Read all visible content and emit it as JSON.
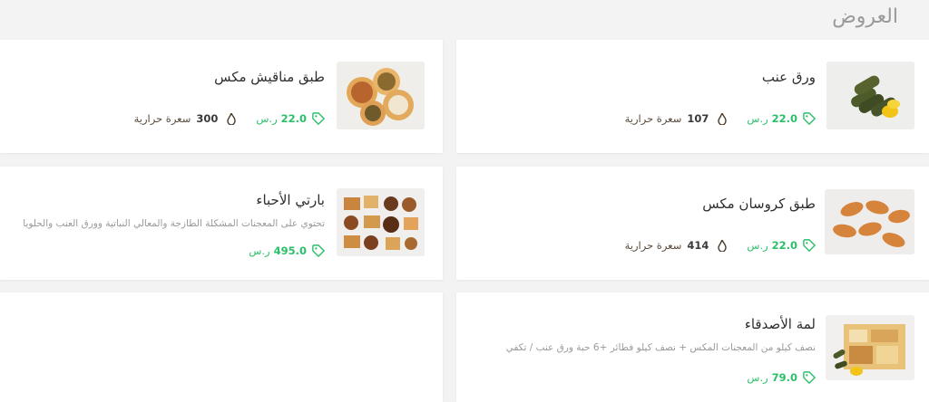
{
  "section": {
    "title": "العروض"
  },
  "offers": [
    {
      "name": "ورق عنب",
      "price": "22.0",
      "currency": "ر.س",
      "calories": "107",
      "calories_unit": "سعرة حرارية",
      "image": "stuffed-grape-leaves-with-lemon"
    },
    {
      "name": "طبق مناقيش مكس",
      "price": "22.0",
      "currency": "ر.س",
      "calories": "300",
      "calories_unit": "سعرة حرارية",
      "image": "mixed-manakish-plate"
    },
    {
      "name": "طبق كروسان مكس",
      "price": "22.0",
      "currency": "ر.س",
      "calories": "414",
      "calories_unit": "سعرة حرارية",
      "image": "mixed-croissant-plate"
    },
    {
      "name": "بارتي الأحباء",
      "description": "تحتوي على المعجنات المشكلة الطازجة والمعالي النباتية وورق العنب والحلويا",
      "price": "495.0",
      "currency": "ر.س",
      "image": "party-platter"
    },
    {
      "name": "لمة الأصدقاء",
      "description_line1": "نصف كيلو من المعجنات المكس + نصف كيلو فطائر +6 حبة ورق عنب / تكفي",
      "description_line2": "",
      "price": "79.0",
      "currency": "ر.س",
      "image": "friends-gathering-platter"
    }
  ],
  "colors": {
    "price": "#2bbf6a",
    "title": "#9a9a9a",
    "background": "#f3f3f3"
  }
}
